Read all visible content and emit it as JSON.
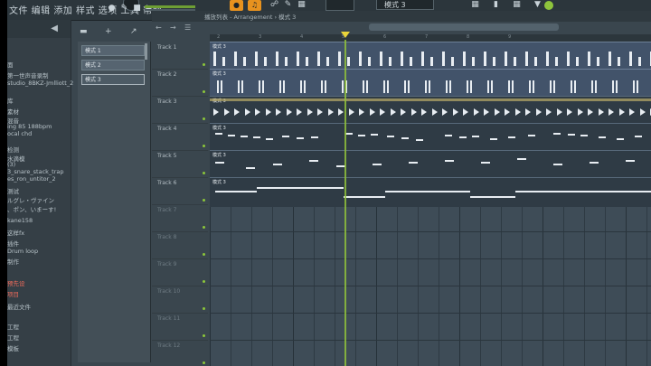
{
  "toolbar": {
    "menu_text": "文件 编辑 添加 样式 选项 工具 帮助",
    "pattern_selector": "模式 3",
    "accent_color": "#e8921e",
    "led_color": "#8ec43c"
  },
  "browser": {
    "items": [
      {
        "text": "面"
      },
      {
        "text": "第一世声音录制"
      },
      {
        "text": "studio_8BKZ-Jmlliott_2"
      },
      {
        "text": "库"
      },
      {
        "text": "素材"
      },
      {
        "text": "混音"
      },
      {
        "text": "ing 85 188bpm"
      },
      {
        "text": "ocal chd"
      },
      {
        "text": "检测"
      },
      {
        "text": "水滴模"
      },
      {
        "text": "(3)"
      },
      {
        "text": "3_snare_stack_trap"
      },
      {
        "text": "es_ron_untitor_2"
      },
      {
        "text": "测试"
      },
      {
        "text": "ルグレ・ヴァイン"
      },
      {
        "text": "、ポン、いまーす!"
      },
      {
        "text": "kane158"
      },
      {
        "text": "这样fx"
      },
      {
        "text": "插件"
      },
      {
        "text": "Drum loop"
      },
      {
        "text": "制作"
      },
      {
        "text": "预先设"
      },
      {
        "text": "项目"
      },
      {
        "text": "最近文件"
      },
      {
        "text": "工程"
      },
      {
        "text": "工程"
      },
      {
        "text": "模板"
      }
    ]
  },
  "picker": {
    "patterns": [
      {
        "label": "模式 1"
      },
      {
        "label": "模式 2"
      },
      {
        "label": "模式 3"
      }
    ]
  },
  "playlist": {
    "title": "播放列表 - Arrangement › 模式 3",
    "tracks": [
      {
        "name": "Track 1"
      },
      {
        "name": "Track 2"
      },
      {
        "name": "Track 3"
      },
      {
        "name": "Track 4"
      },
      {
        "name": "Track 5"
      },
      {
        "name": "Track 6"
      },
      {
        "name": "Track 7"
      },
      {
        "name": "Track 8"
      },
      {
        "name": "Track 9"
      },
      {
        "name": "Track 10"
      },
      {
        "name": "Track 11"
      },
      {
        "name": "Track 12"
      }
    ],
    "clip_label": "模式 3",
    "ruler": [
      "2",
      "3",
      "4",
      "5",
      "6",
      "7",
      "8",
      "9"
    ],
    "playhead_color": "#8fc13b"
  }
}
